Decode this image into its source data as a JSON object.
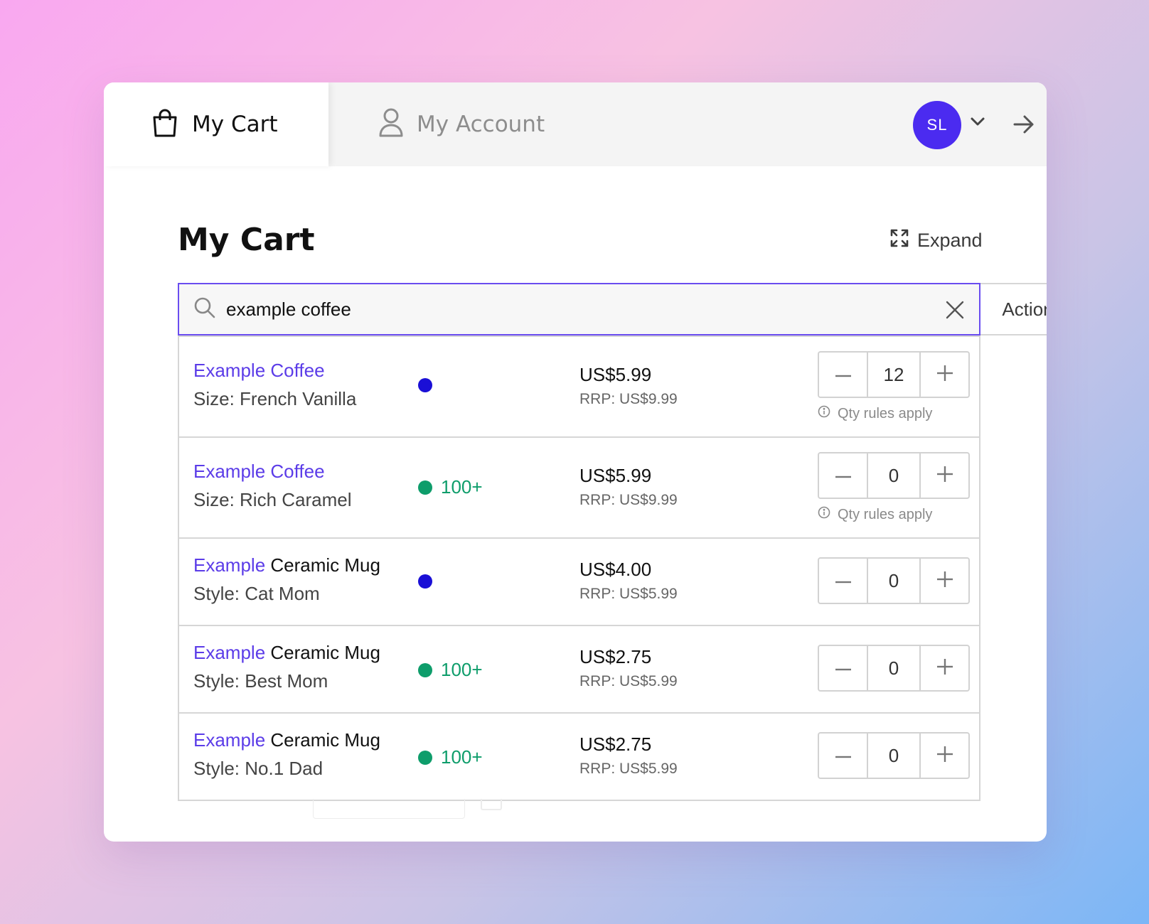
{
  "tabs": {
    "cart_label": "My Cart",
    "account_label": "My Account"
  },
  "user": {
    "initials": "SL"
  },
  "page": {
    "title": "My Cart",
    "expand_label": "Expand"
  },
  "search": {
    "value": "example coffee",
    "actions_label": "Actions"
  },
  "items": [
    {
      "brand": "Example",
      "name": "Coffee",
      "brand_only_colored": false,
      "variant": "Size: French Vanilla",
      "stock_dot": "blue",
      "stock_text": "",
      "price": "US$5.99",
      "rrp": "RRP: US$9.99",
      "qty": "12",
      "qty_rules": "Qty rules apply"
    },
    {
      "brand": "Example",
      "name": "Coffee",
      "brand_only_colored": false,
      "variant": "Size: Rich Caramel",
      "stock_dot": "green",
      "stock_text": "100+",
      "price": "US$5.99",
      "rrp": "RRP: US$9.99",
      "qty": "0",
      "qty_rules": "Qty rules apply"
    },
    {
      "brand": "Example",
      "name": "Ceramic Mug",
      "brand_only_colored": true,
      "variant": "Style: Cat Mom",
      "stock_dot": "blue",
      "stock_text": "",
      "price": "US$4.00",
      "rrp": "RRP: US$5.99",
      "qty": "0",
      "qty_rules": ""
    },
    {
      "brand": "Example",
      "name": "Ceramic Mug",
      "brand_only_colored": true,
      "variant": "Style: Best Mom",
      "stock_dot": "green",
      "stock_text": "100+",
      "price": "US$2.75",
      "rrp": "RRP: US$5.99",
      "qty": "0",
      "qty_rules": ""
    },
    {
      "brand": "Example",
      "name": "Ceramic Mug",
      "brand_only_colored": true,
      "variant": "Style: No.1 Dad",
      "stock_dot": "green",
      "stock_text": "100+",
      "price": "US$2.75",
      "rrp": "RRP: US$5.99",
      "qty": "0",
      "qty_rules": ""
    }
  ],
  "colors": {
    "accent": "#5b3ce8",
    "avatar": "#4b2bf0",
    "in_stock": "#0e9d6b",
    "stock_blue": "#1a0fd6"
  },
  "icons": [
    "shopping-bag-icon",
    "user-icon",
    "chevron-down-icon",
    "arrow-right-icon",
    "expand-icon",
    "search-icon",
    "close-icon",
    "minus-icon",
    "plus-icon",
    "info-icon"
  ]
}
